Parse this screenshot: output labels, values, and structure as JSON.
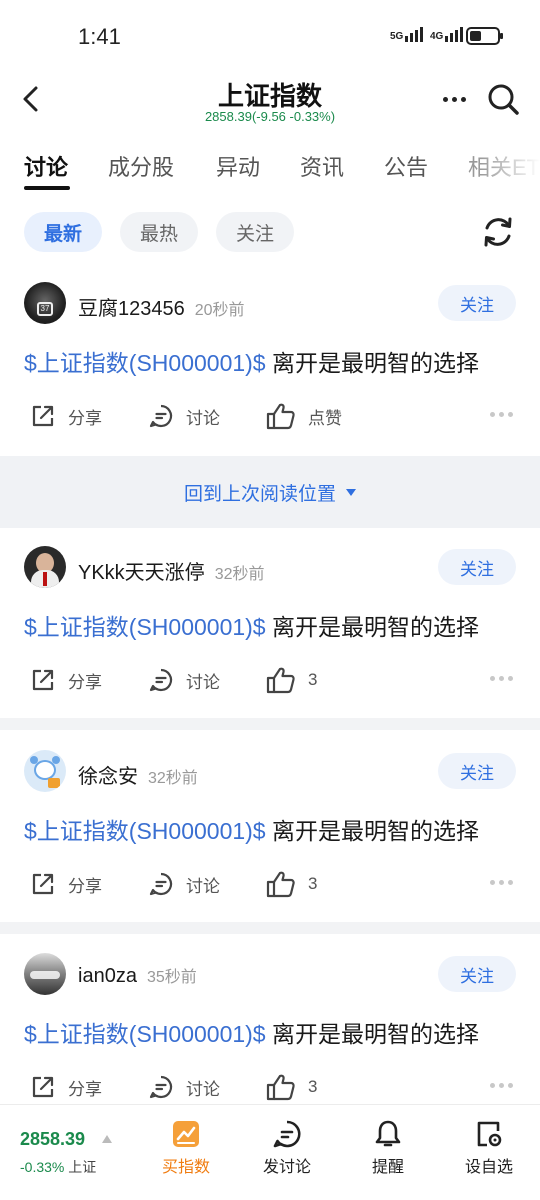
{
  "status_bar": {
    "time": "1:41",
    "sim1": "5G",
    "sim2": "4G",
    "battery_level": 0.35
  },
  "header": {
    "title": "上证指数",
    "subtitle": "2858.39(-9.56 -0.33%)"
  },
  "tabs": [
    "讨论",
    "成分股",
    "异动",
    "资讯",
    "公告",
    "相关ETF"
  ],
  "filters": [
    "最新",
    "最热",
    "关注"
  ],
  "resume_label": "回到上次阅读位置",
  "posts": [
    {
      "user": "豆腐123456",
      "time": "20秒前",
      "follow": "关注",
      "stock": "$上证指数(SH000001)$",
      "text": " 离开是最明智的选择",
      "share": "分享",
      "discuss": "讨论",
      "like": "点赞"
    },
    {
      "user": "YKkk天天涨停",
      "time": "32秒前",
      "follow": "关注",
      "stock": "$上证指数(SH000001)$",
      "text": " 离开是最明智的选择",
      "share": "分享",
      "discuss": "讨论",
      "like": "3"
    },
    {
      "user": "徐念安",
      "time": "32秒前",
      "follow": "关注",
      "stock": "$上证指数(SH000001)$",
      "text": " 离开是最明智的选择",
      "share": "分享",
      "discuss": "讨论",
      "like": "3"
    },
    {
      "user": "ian0za",
      "time": "35秒前",
      "follow": "关注",
      "stock": "$上证指数(SH000001)$",
      "text": " 离开是最明智的选择",
      "share": "分享",
      "discuss": "讨论",
      "like": "3"
    }
  ],
  "bottom": {
    "price": "2858.39",
    "change": "-0.33%",
    "index_name": "上证",
    "nav": [
      "买指数",
      "发讨论",
      "提醒",
      "设自选"
    ]
  },
  "colors": {
    "accent": "#2f6fe0",
    "down": "#1b8a4c",
    "buy": "#f07c10"
  }
}
